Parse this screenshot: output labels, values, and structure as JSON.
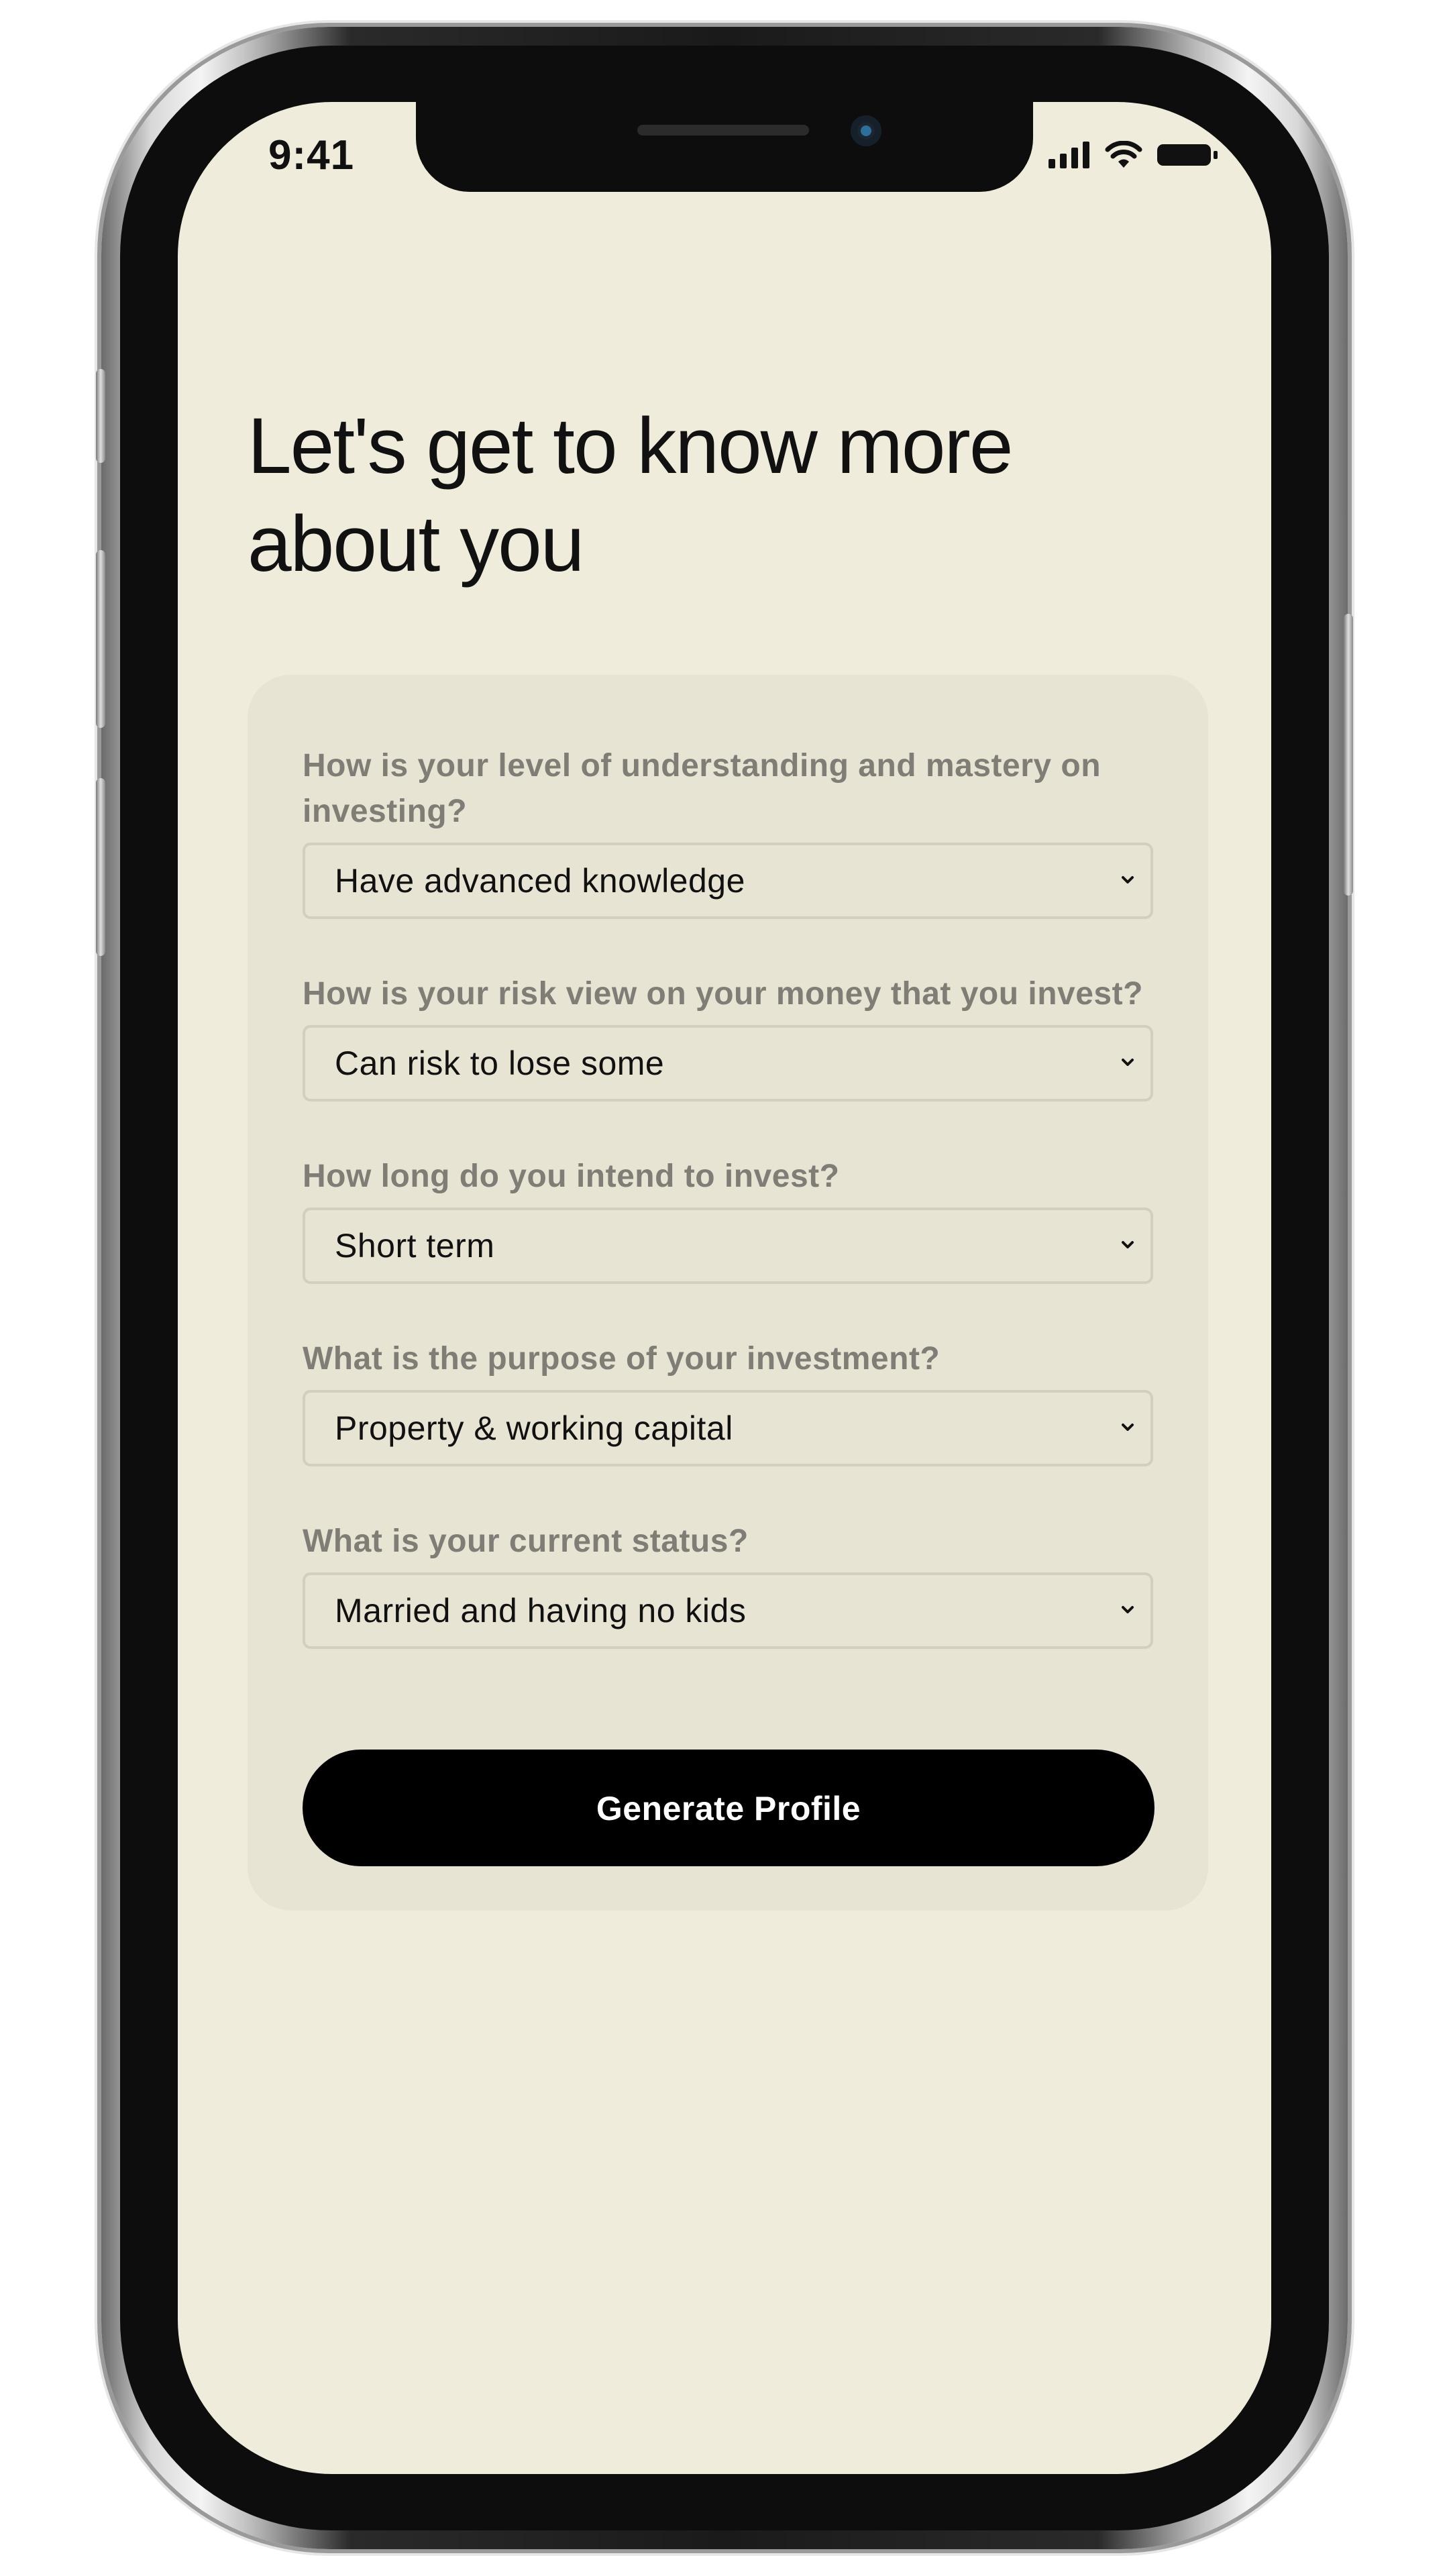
{
  "status_bar": {
    "time": "9:41",
    "icons": [
      "signal-icon",
      "wifi-icon",
      "battery-icon"
    ]
  },
  "page": {
    "title": "Let's get to know more about you"
  },
  "form": {
    "questions": [
      {
        "label": "How is your level of understanding and mastery on investing?",
        "selected": "Have advanced knowledge"
      },
      {
        "label": "How is your risk view on your money that you invest?",
        "selected": "Can risk to lose some"
      },
      {
        "label": "How long do you intend to invest?",
        "selected": "Short term"
      },
      {
        "label": "What is the purpose of your investment?",
        "selected": "Property & working capital"
      },
      {
        "label": "What is your current status?",
        "selected": "Married and having no kids"
      }
    ],
    "submit_label": "Generate Profile"
  },
  "colors": {
    "screen_background": "#f0ecdb",
    "card_background": "#e8e4d3",
    "question_text": "#7f7d75",
    "button_background": "#000000",
    "button_text": "#ffffff"
  }
}
